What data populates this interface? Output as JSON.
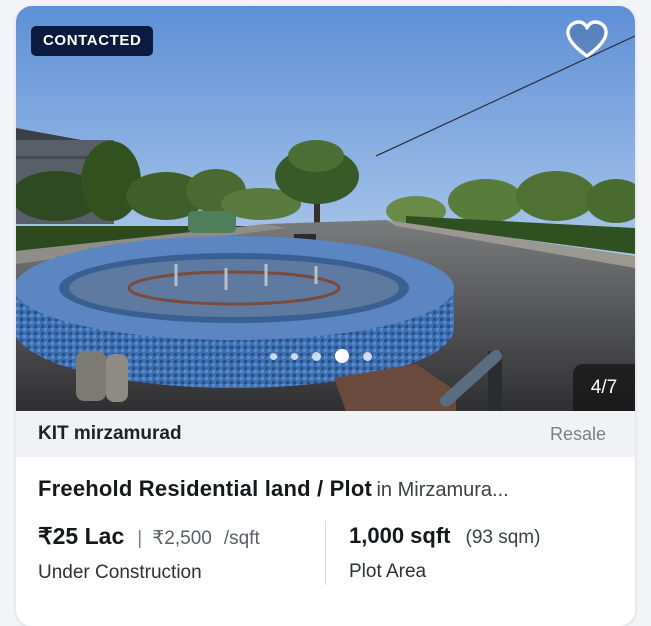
{
  "listing": {
    "badge": "CONTACTED",
    "image_counter": "4/7",
    "carousel": {
      "total_dots": 5,
      "active_index": 3
    },
    "project_name": "KIT mirzamurad",
    "transaction_type": "Resale",
    "title": "Freehold Residential land / Plot",
    "location": "in Mirzamura...",
    "price": "₹25 Lac",
    "price_separator": "|",
    "price_per_sqft": "₹2,500",
    "price_unit": "/sqft",
    "status": "Under Construction",
    "area": "1,000 sqft",
    "area_alt": "(93 sqm)",
    "area_label": "Plot Area"
  },
  "icons": {
    "favorite": "heart-outline-icon"
  },
  "colors": {
    "badge_bg": "#0b1b3f",
    "strip_bg": "#f0f2f5",
    "card_bg": "#ffffff"
  }
}
